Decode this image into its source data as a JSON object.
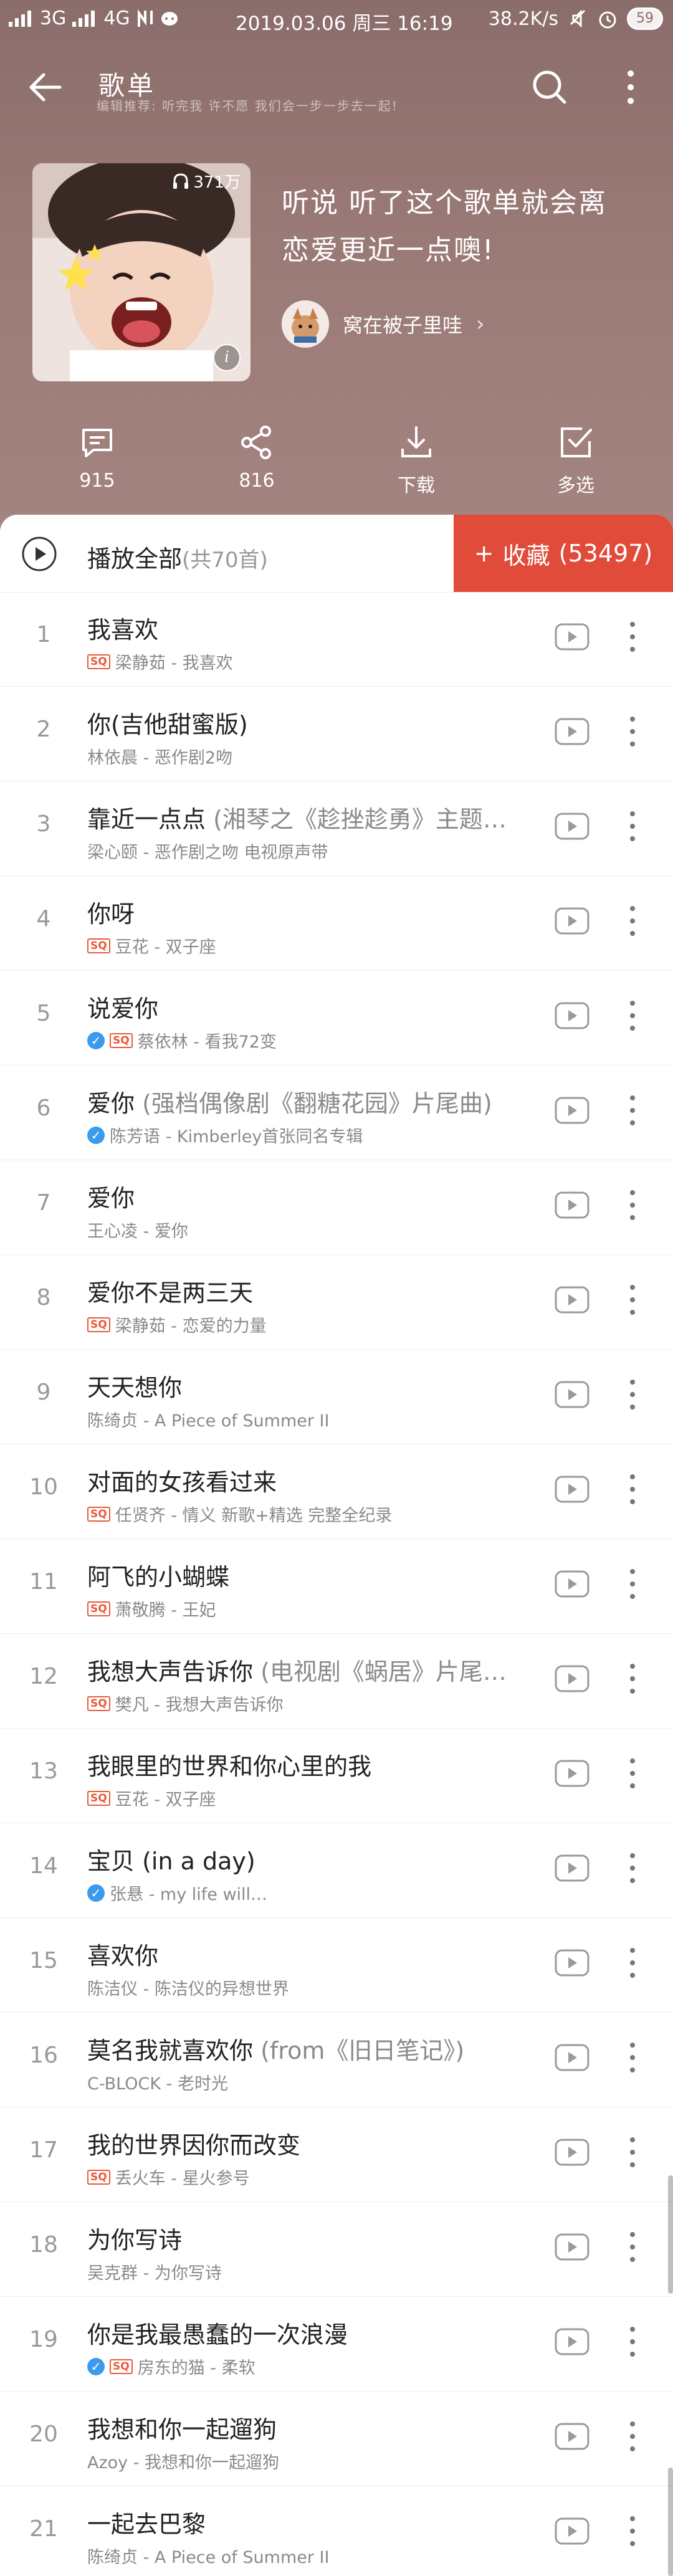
{
  "status": {
    "signal": "3G",
    "signal2": "4G",
    "time": "2019.03.06 周三 16:19",
    "speed": "38.2K/s",
    "battery": "59"
  },
  "header": {
    "title": "歌单",
    "subtitle": "编辑推荐: 听完我 许不愿 我们会一步一步去一起!",
    "play_count": "371万",
    "playlist_title": "听说 听了这个歌单就会离恋爱更近一点噢!",
    "creator": "窝在被子里哇"
  },
  "actions": {
    "comments": "915",
    "share": "816",
    "download": "下载",
    "multi": "多选"
  },
  "playall": {
    "label": "播放全部",
    "count": "(共70首)",
    "collect_label": "收藏",
    "collect_count": "(53497)"
  },
  "songs": [
    {
      "index": "1",
      "title": "我喜欢",
      "extra": "",
      "sq": true,
      "verified": false,
      "meta": "梁静茹 - 我喜欢"
    },
    {
      "index": "2",
      "title": "你(吉他甜蜜版)",
      "extra": "",
      "sq": false,
      "verified": false,
      "meta": "林依晨 - 恶作剧2吻"
    },
    {
      "index": "3",
      "title": "靠近一点点",
      "extra": " (湘琴之《趁挫趁勇》主题…",
      "sq": false,
      "verified": false,
      "meta": "梁心颐 - 恶作剧之吻 电视原声带"
    },
    {
      "index": "4",
      "title": "你呀",
      "extra": "",
      "sq": true,
      "verified": false,
      "meta": "豆花 - 双子座"
    },
    {
      "index": "5",
      "title": "说爱你",
      "extra": "",
      "sq": true,
      "verified": true,
      "meta": "蔡依林 - 看我72变"
    },
    {
      "index": "6",
      "title": "爱你",
      "extra": " (强档偶像剧《翻糖花园》片尾曲)",
      "sq": false,
      "verified": true,
      "meta": "陈芳语 - Kimberley首张同名专辑"
    },
    {
      "index": "7",
      "title": "爱你",
      "extra": "",
      "sq": false,
      "verified": false,
      "meta": "王心凌 - 爱你"
    },
    {
      "index": "8",
      "title": "爱你不是两三天",
      "extra": "",
      "sq": true,
      "verified": false,
      "meta": "梁静茹 - 恋爱的力量"
    },
    {
      "index": "9",
      "title": "天天想你",
      "extra": "",
      "sq": false,
      "verified": false,
      "meta": "陈绮贞 - A Piece of Summer II"
    },
    {
      "index": "10",
      "title": "对面的女孩看过来",
      "extra": "",
      "sq": true,
      "verified": false,
      "meta": "任贤齐 - 情义 新歌+精选 完整全纪录"
    },
    {
      "index": "11",
      "title": "阿飞的小蝴蝶",
      "extra": "",
      "sq": true,
      "verified": false,
      "meta": "萧敬腾 - 王妃"
    },
    {
      "index": "12",
      "title": "我想大声告诉你",
      "extra": " (电视剧《蜗居》片尾…",
      "sq": true,
      "verified": false,
      "meta": "樊凡 - 我想大声告诉你"
    },
    {
      "index": "13",
      "title": "我眼里的世界和你心里的我",
      "extra": "",
      "sq": true,
      "verified": false,
      "meta": "豆花 - 双子座"
    },
    {
      "index": "14",
      "title": "宝贝 (in a day)",
      "extra": "",
      "sq": false,
      "verified": true,
      "meta": "张悬 - my life will…"
    },
    {
      "index": "15",
      "title": "喜欢你",
      "extra": "",
      "sq": false,
      "verified": false,
      "meta": "陈洁仪 - 陈洁仪的异想世界"
    },
    {
      "index": "16",
      "title": "莫名我就喜欢你",
      "extra": " (from《旧日笔记》)",
      "sq": false,
      "verified": false,
      "meta": "C-BLOCK - 老时光"
    },
    {
      "index": "17",
      "title": "我的世界因你而改变",
      "extra": "",
      "sq": true,
      "verified": false,
      "meta": "丢火车 - 星火参号"
    },
    {
      "index": "18",
      "title": "为你写诗",
      "extra": "",
      "sq": false,
      "verified": false,
      "meta": "吴克群 - 为你写诗"
    },
    {
      "index": "19",
      "title": "你是我最愚蠢的一次浪漫",
      "extra": "",
      "sq": true,
      "verified": true,
      "meta": "房东的猫 - 柔软"
    },
    {
      "index": "20",
      "title": "我想和你一起遛狗",
      "extra": "",
      "sq": false,
      "verified": false,
      "meta": "Azoy - 我想和你一起遛狗"
    },
    {
      "index": "21",
      "title": "一起去巴黎",
      "extra": "",
      "sq": false,
      "verified": false,
      "meta": "陈绮贞 - A Piece of Summer II"
    }
  ],
  "colors": {
    "accent": "#e04b3a",
    "header_bg": "#9a7a76"
  }
}
